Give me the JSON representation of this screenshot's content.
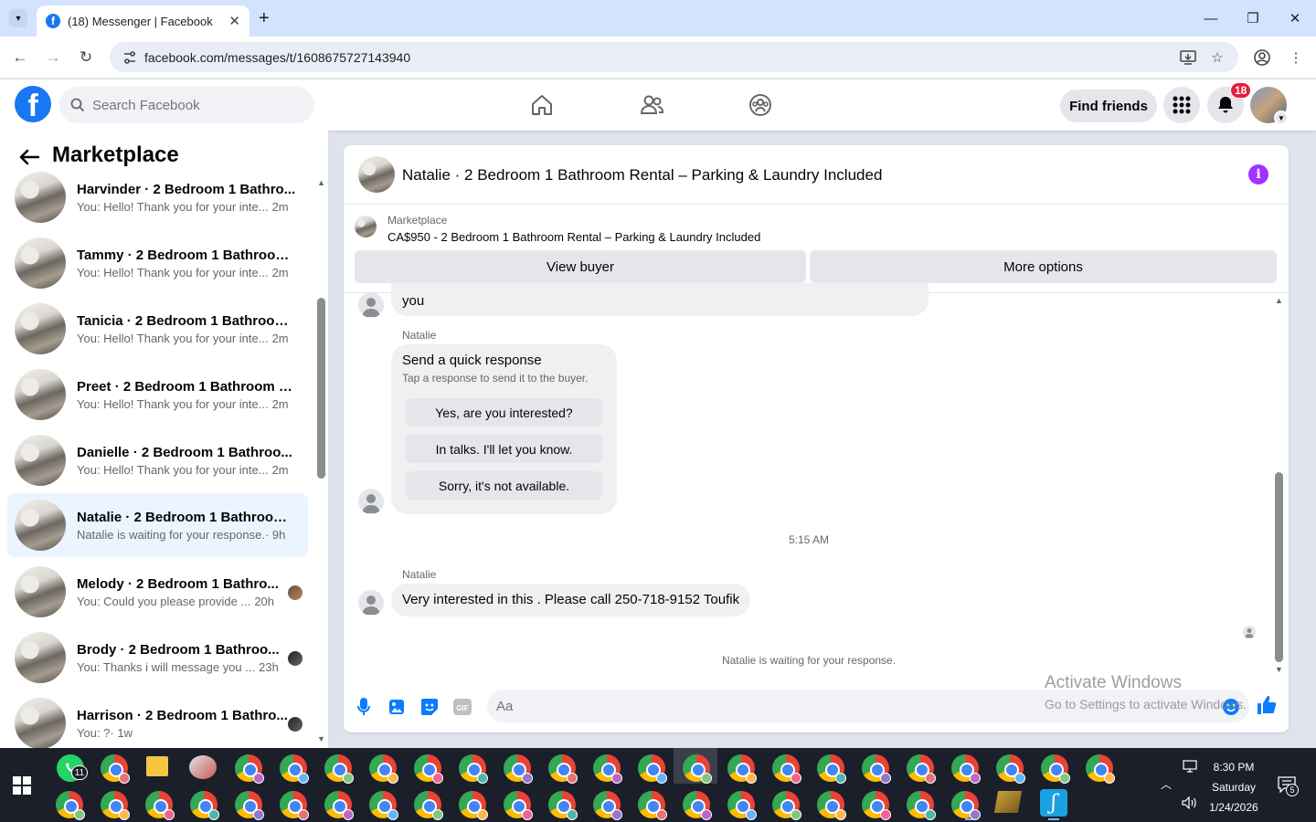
{
  "browser": {
    "tab_title": "(18) Messenger | Facebook",
    "url": "facebook.com/messages/t/1608675727143940"
  },
  "header": {
    "search_placeholder": "Search Facebook",
    "find_friends": "Find friends",
    "notification_count": "18"
  },
  "sidebar": {
    "title": "Marketplace",
    "conversations": [
      {
        "name": "Harvinder · 2 Bedroom 1 Bathro...",
        "preview": "You: Hello! Thank you for your inte...",
        "time": "2m"
      },
      {
        "name": "Tammy · 2 Bedroom 1 Bathroom...",
        "preview": "You: Hello! Thank you for your inte...",
        "time": "2m"
      },
      {
        "name": "Tanicia · 2 Bedroom 1 Bathroom ...",
        "preview": "You: Hello! Thank you for your inte...",
        "time": "2m"
      },
      {
        "name": "Preet · 2 Bedroom 1 Bathroom R...",
        "preview": "You: Hello! Thank you for your inte...",
        "time": "2m"
      },
      {
        "name": "Danielle · 2 Bedroom 1 Bathroo...",
        "preview": "You: Hello! Thank you for your inte...",
        "time": "2m"
      },
      {
        "name": "Natalie · 2 Bedroom 1 Bathroom...",
        "preview": "Natalie is waiting for your response.",
        "time": "· 9h"
      },
      {
        "name": "Melody · 2 Bedroom 1 Bathro...",
        "preview": "You: Could you please provide ...",
        "time": "20h"
      },
      {
        "name": "Brody · 2 Bedroom 1 Bathroo...",
        "preview": "You: Thanks i will message you ...",
        "time": "23h"
      },
      {
        "name": "Harrison · 2 Bedroom 1 Bathro...",
        "preview": "You: ?",
        "time": "· 1w"
      }
    ]
  },
  "chat": {
    "title": "Natalie · 2 Bedroom 1 Bathroom Rental – Parking & Laundry Included",
    "listing_label": "Marketplace",
    "listing_price_title": "CA$950 - 2 Bedroom 1 Bathroom Rental – Parking & Laundry Included",
    "view_buyer": "View buyer",
    "more_options": "More options",
    "partial_message": "you",
    "quick_sender": "Natalie",
    "quick_title": "Send a quick response",
    "quick_subtitle": "Tap a response to send it to the buyer.",
    "quick_responses": [
      "Yes, are you interested?",
      "In talks. I'll let you know.",
      "Sorry, it's not available."
    ],
    "timestamp": "5:15 AM",
    "msg_sender": "Natalie",
    "message": "Very interested in this . Please call 250-718-9152 Toufik",
    "status": "Natalie is waiting for your response.",
    "composer_placeholder": "Aa"
  },
  "watermark": {
    "line1": "Activate Windows",
    "line2": "Go to Settings to activate Windows."
  },
  "taskbar": {
    "time": "8:30 PM",
    "day": "Saturday",
    "date": "1/24/2026",
    "whatsapp_badge": "11",
    "notif_count": "5"
  },
  "colors": {
    "fb_blue": "#1877f2",
    "messenger_purple": "#a033ff",
    "active_row": "#ebf5ff"
  }
}
